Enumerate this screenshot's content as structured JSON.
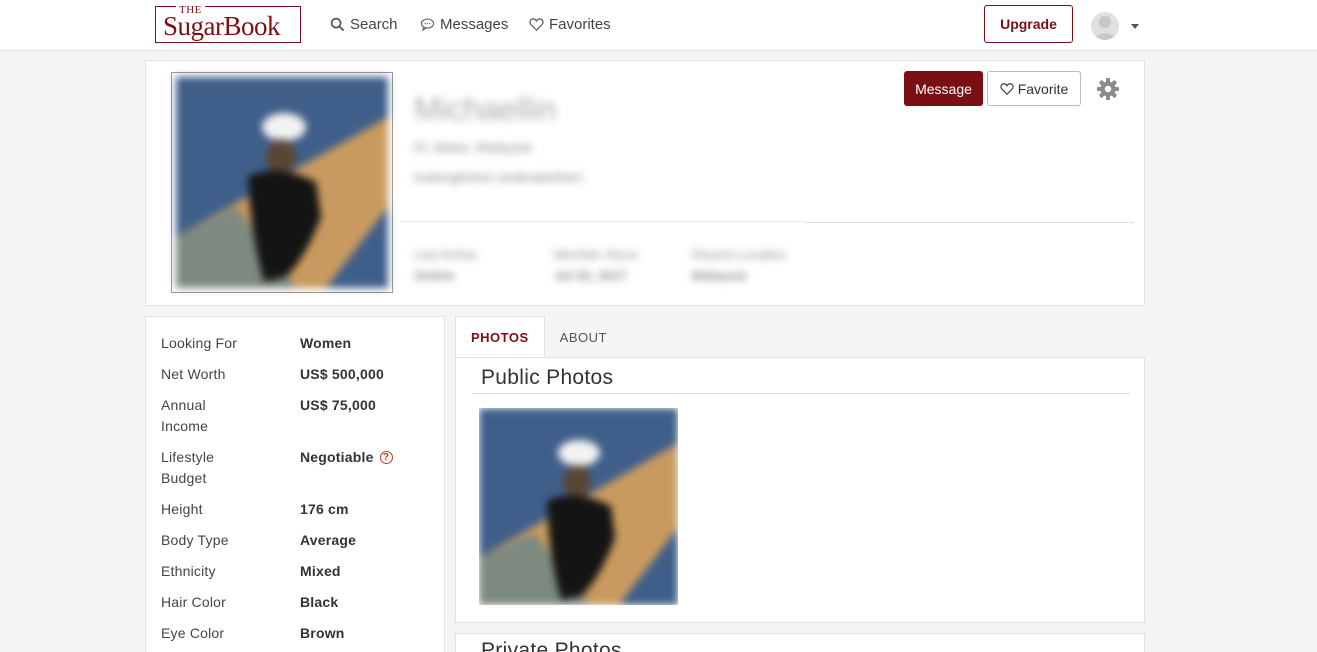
{
  "nav": {
    "logo_the": "THE",
    "logo_brand": "SugarBook",
    "search": "Search",
    "messages": "Messages",
    "favorites": "Favorites",
    "upgrade": "Upgrade"
  },
  "profile": {
    "name": "Michaellin",
    "location": "Kl, Malur, Malaysia",
    "tagline": "lookingforfun andmakefrien",
    "stats": [
      {
        "label": "Last Active",
        "value": "Online"
      },
      {
        "label": "Member Since",
        "value": "Jul 02, 2017"
      },
      {
        "label": "Recent Location",
        "value": "Malaysia"
      }
    ],
    "actions": {
      "message": "Message",
      "favorite": "Favorite"
    }
  },
  "details": [
    {
      "label": "Looking For",
      "value": "Women"
    },
    {
      "label": "Net Worth",
      "value": "US$ 500,000"
    },
    {
      "label": "Annual Income",
      "value": "US$ 75,000"
    },
    {
      "label": "Lifestyle Budget",
      "value": "Negotiable",
      "help_icon": "?"
    },
    {
      "label": "Height",
      "value": "176 cm"
    },
    {
      "label": "Body Type",
      "value": "Average"
    },
    {
      "label": "Ethnicity",
      "value": "Mixed"
    },
    {
      "label": "Hair Color",
      "value": "Black"
    },
    {
      "label": "Eye Color",
      "value": "Brown"
    }
  ],
  "tabs": [
    {
      "label": "PHOTOS",
      "active": true
    },
    {
      "label": "ABOUT",
      "active": false
    }
  ],
  "sections": {
    "public_photos": "Public Photos",
    "private_photos": "Private Photos"
  },
  "colors": {
    "brand": "#7a1014",
    "help": "#c0392b"
  },
  "icons": [
    "search-icon",
    "chat-bubble-icon",
    "heart-icon",
    "gear-icon",
    "user-avatar-icon",
    "help-circle-icon"
  ]
}
